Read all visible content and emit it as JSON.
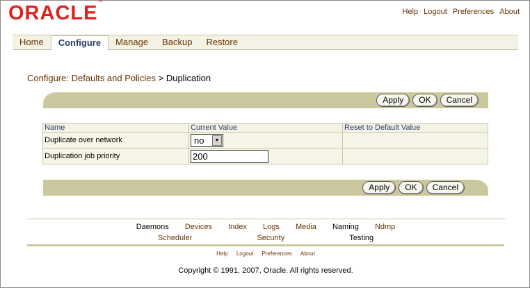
{
  "brand": {
    "logo_text": "ORACLE",
    "trademark": "®"
  },
  "global_links": [
    "Help",
    "Logout",
    "Preferences",
    "About"
  ],
  "tabs": [
    {
      "label": "Home",
      "active": false
    },
    {
      "label": "Configure",
      "active": true
    },
    {
      "label": "Manage",
      "active": false
    },
    {
      "label": "Backup",
      "active": false
    },
    {
      "label": "Restore",
      "active": false
    }
  ],
  "breadcrumb": {
    "parent": "Configure: Defaults and Policies",
    "separator": " > ",
    "current": "Duplication"
  },
  "actions": {
    "apply": "Apply",
    "ok": "OK",
    "cancel": "Cancel"
  },
  "table": {
    "headers": [
      "Name",
      "Current Value",
      "Reset to Default Value"
    ],
    "rows": [
      {
        "name": "Duplicate over network",
        "value": "no",
        "control": "select"
      },
      {
        "name": "Duplication job priority",
        "value": "200",
        "control": "text"
      }
    ]
  },
  "footer": {
    "row1": [
      "Daemons",
      "Devices",
      "Index",
      "Logs",
      "Media",
      "Naming",
      "Ndmp"
    ],
    "row2": [
      "Scheduler",
      "Security",
      "Testing"
    ],
    "small_links": [
      "Help",
      "Logout",
      "Preferences",
      "About"
    ],
    "copyright": "Copyright © 1991, 2007, Oracle. All rights reserved."
  },
  "colors": {
    "accent_red": "#e0201c",
    "link": "#663300",
    "header_text": "#2a3e6a",
    "band": "#ccc89e"
  }
}
